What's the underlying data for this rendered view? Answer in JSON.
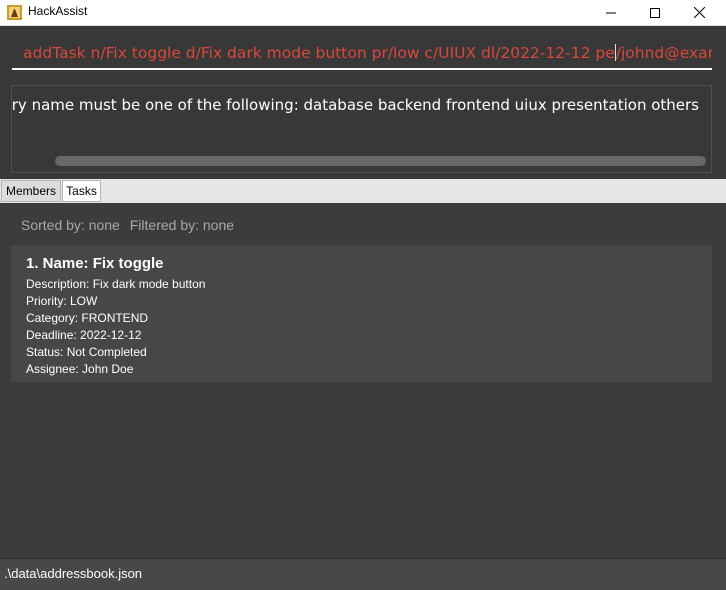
{
  "window": {
    "title": "HackAssist",
    "minimize_icon": "minimize-icon",
    "maximize_icon": "maximize-icon",
    "close_icon": "close-icon"
  },
  "command": {
    "before_caret": "addTask n/Fix toggle d/Fix dark mode button pr/low c/UIUX dl/2022-12-12 pe",
    "after_caret": "/johnd@exampl"
  },
  "result": {
    "message": "Category name must be one of the following:  database backend frontend uiux presentation others"
  },
  "tabs": [
    {
      "label": "Members"
    },
    {
      "label": "Tasks"
    }
  ],
  "list": {
    "sorted_by": "Sorted by: none",
    "filtered_by": "Filtered by: none",
    "tasks": [
      {
        "title": "1. Name: Fix toggle",
        "description": "Description: Fix dark mode button",
        "priority": "Priority: LOW",
        "category": "Category: FRONTEND",
        "deadline": "Deadline: 2022-12-12",
        "status": "Status: Not Completed",
        "assignee": "Assignee: John Doe"
      }
    ]
  },
  "status_bar": {
    "path": ".\\data\\addressbook.json"
  },
  "colors": {
    "command_text": "#d9483b",
    "background": "#383838",
    "card": "#474747"
  }
}
